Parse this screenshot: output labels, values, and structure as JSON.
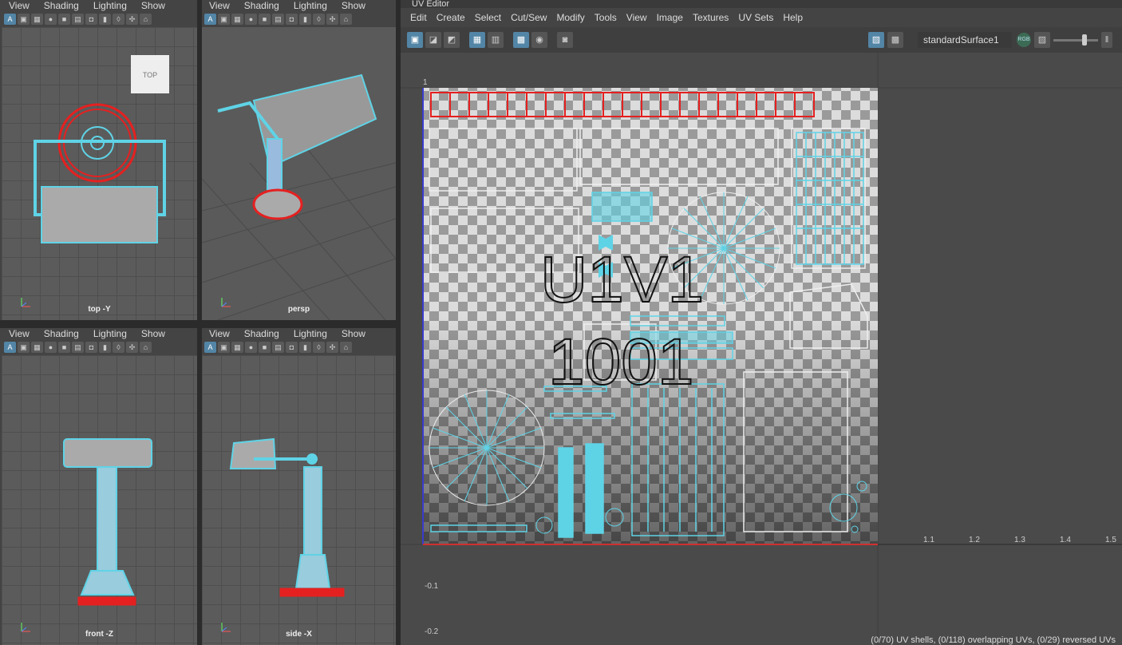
{
  "viewport_menu": [
    "View",
    "Shading",
    "Lighting",
    "Show"
  ],
  "viewports": {
    "top": {
      "label": "top -Y",
      "cube_label": "TOP"
    },
    "persp": {
      "label": "persp"
    },
    "front": {
      "label": "front -Z"
    },
    "side": {
      "label": "side -X"
    }
  },
  "uv_editor": {
    "title": "UV Editor",
    "menu": [
      "Edit",
      "Create",
      "Select",
      "Cut/Sew",
      "Modify",
      "Tools",
      "View",
      "Image",
      "Textures",
      "UV Sets",
      "Help"
    ],
    "shader_name": "standardSurface1",
    "rgb_label": "RGB",
    "texture_label_top": "U1V1",
    "texture_label_bottom": "1001",
    "axis_ticks_x": [
      "1.1",
      "1.2",
      "1.3",
      "1.4",
      "1.5"
    ],
    "axis_ticks_y": [
      "1",
      "-0.1",
      "-0.2"
    ],
    "status": "(0/70) UV shells, (0/118) overlapping UVs, (0/29) reversed UVs"
  },
  "colors": {
    "accent": "#5285a6",
    "wire": "#5fd3e6",
    "selected": "#e52020",
    "bg": "#444444"
  },
  "icons": {
    "axis": "axis-gizmo-icon",
    "camera": "camera-icon",
    "checker": "checker-icon"
  }
}
